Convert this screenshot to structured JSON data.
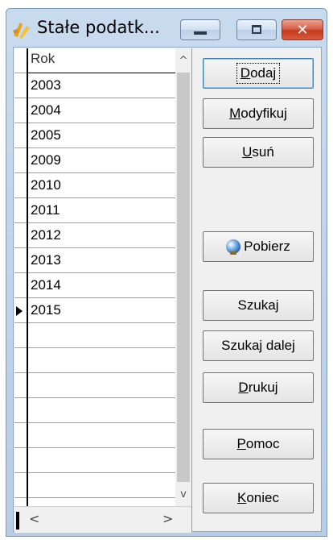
{
  "window": {
    "title": "Stałe podatk...",
    "close_glyph": "✕"
  },
  "grid": {
    "header": "Rok",
    "rows": [
      "2003",
      "2004",
      "2005",
      "2009",
      "2010",
      "2011",
      "2012",
      "2013",
      "2014",
      "2015"
    ],
    "current_row_index": 9,
    "scroll_up_glyph": "^",
    "scroll_down_glyph": "v",
    "scroll_left_glyph": "<",
    "scroll_right_glyph": ">"
  },
  "buttons": {
    "dodaj": {
      "pre": "",
      "u": "D",
      "post": "odaj"
    },
    "modyfikuj": {
      "pre": "",
      "u": "M",
      "post": "odyfikuj"
    },
    "usun": {
      "pre": "",
      "u": "U",
      "post": "suń"
    },
    "pobierz": {
      "label": "Pobierz",
      "icon": "globe-icon"
    },
    "szukaj": {
      "label": "Szukaj"
    },
    "szukaj_dalej": {
      "label": "Szukaj dalej"
    },
    "drukuj": {
      "pre": "",
      "u": "D",
      "post": "rukuj"
    },
    "pomoc": {
      "pre": "",
      "u": "P",
      "post": "omoc"
    },
    "koniec": {
      "pre": "",
      "u": "K",
      "post": "oniec"
    }
  }
}
